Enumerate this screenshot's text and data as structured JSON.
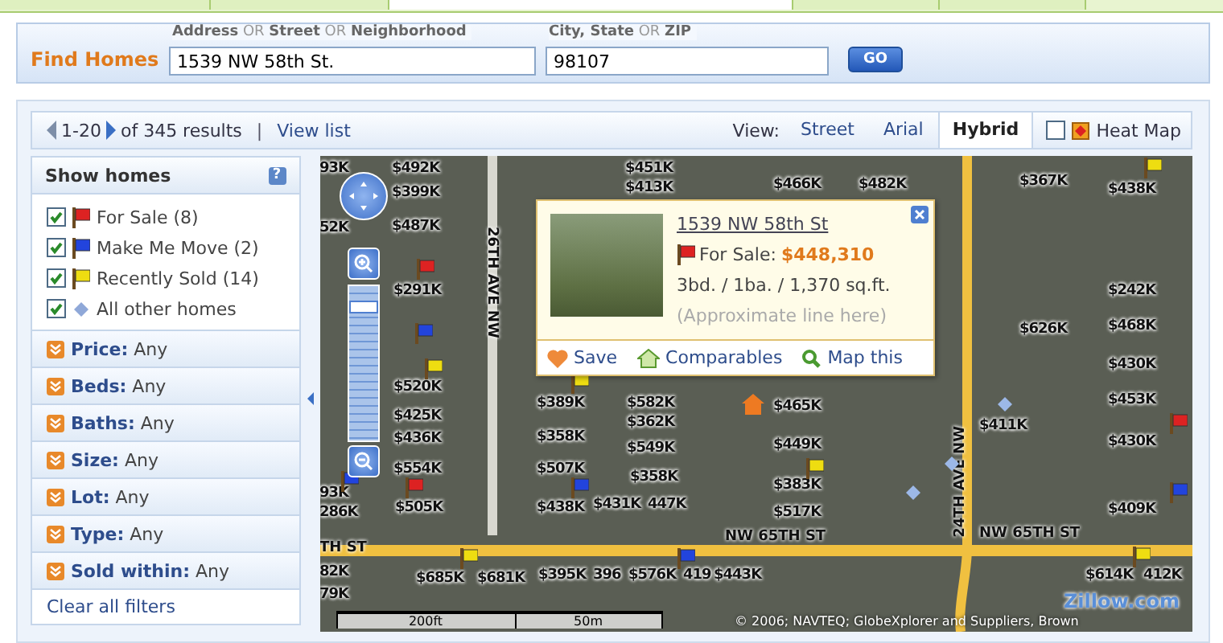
{
  "search": {
    "title": "Find Homes",
    "address": {
      "label": "**Address** OR **Street** OR **Neighborhood**",
      "value": "1539 NW 58th St."
    },
    "city": {
      "label": "**City, State** OR **ZIP**",
      "value": "98107"
    },
    "button": "GO"
  },
  "results": {
    "range": "1-20",
    "total": "of 345 results",
    "separator": "|",
    "view_list": "View list",
    "view_label": "View:",
    "views": [
      {
        "label": "Street",
        "selected": false
      },
      {
        "label": "Arial",
        "selected": false
      },
      {
        "label": "Hybrid",
        "selected": true
      }
    ],
    "heat_map": {
      "label": "Heat Map",
      "checked": false
    }
  },
  "sidebar": {
    "title": "Show homes",
    "help": "?",
    "home_types": [
      {
        "label": "For Sale (8)",
        "checked": true,
        "kind": "flag",
        "color": "#dd2222"
      },
      {
        "label": "Make Me Move (2)",
        "checked": true,
        "kind": "flag",
        "color": "#2244dd"
      },
      {
        "label": "Recently Sold (14)",
        "checked": true,
        "kind": "flag",
        "color": "#eedd11"
      },
      {
        "label": "All other homes",
        "checked": true,
        "kind": "diamond",
        "color": "#8fa8d8"
      }
    ],
    "filters": [
      {
        "name": "Price:",
        "value": "Any"
      },
      {
        "name": "Beds:",
        "value": "Any"
      },
      {
        "name": "Baths:",
        "value": "Any"
      },
      {
        "name": "Size:",
        "value": "Any"
      },
      {
        "name": "Lot:",
        "value": "Any"
      },
      {
        "name": "Type:",
        "value": "Any"
      },
      {
        "name": "Sold within:",
        "value": "Any"
      }
    ],
    "clear": "Clear all filters"
  },
  "map": {
    "zoom": {
      "level": 0.9
    },
    "prices": [
      "$492K",
      "$399K",
      "$487K",
      "$291K",
      "$520K",
      "$425K",
      "$436K",
      "$554K",
      "$505K",
      "$389K",
      "$582K",
      "$362K",
      "$358K",
      "$549K",
      "$507K",
      "$358K",
      "$438K",
      "$431K",
      "447K",
      "$685K",
      "$681K",
      "$395K",
      "396",
      "$576K",
      "419",
      "$443K",
      "$451K",
      "$413K",
      "93K",
      "52K",
      "93K",
      "286K",
      "82K",
      "79K",
      "$466K",
      "$482K",
      "$367K",
      "$438K",
      "$242K",
      "$468K",
      "$626K",
      "$430K",
      "$453K",
      "$465K",
      "$411K",
      "$449K",
      "$430K",
      "$383K",
      "$517K",
      "$409K",
      "$614K",
      "412K"
    ],
    "pins": [
      {
        "kind": "for_sale"
      },
      {
        "kind": "for_sale"
      },
      {
        "kind": "for_sale"
      },
      {
        "kind": "make_me_move"
      },
      {
        "kind": "make_me_move"
      },
      {
        "kind": "make_me_move"
      },
      {
        "kind": "make_me_move"
      },
      {
        "kind": "make_me_move"
      },
      {
        "kind": "recently_sold"
      },
      {
        "kind": "recently_sold"
      },
      {
        "kind": "recently_sold"
      },
      {
        "kind": "recently_sold"
      },
      {
        "kind": "recently_sold"
      },
      {
        "kind": "recently_sold"
      },
      {
        "kind": "other"
      },
      {
        "kind": "other"
      },
      {
        "kind": "other"
      },
      {
        "kind": "selected"
      }
    ],
    "streets": [
      {
        "name": "26TH AVE NW",
        "kind": "down"
      },
      {
        "name": "24TH AVE NW",
        "kind": "up"
      },
      {
        "name": "NW 65TH ST",
        "kind": "across"
      },
      {
        "name": "NW 65TH ST",
        "kind": "across"
      },
      {
        "name": "TH ST",
        "kind": "across"
      }
    ],
    "popup": {
      "address": "1539 NW 58th St",
      "status": "For Sale:",
      "price": "$448,310",
      "details": "3bd. / 1ba. / 1,370 sq.ft.",
      "note": "(Approximate line here)",
      "actions": [
        "Save",
        "Comparables",
        "Map this"
      ]
    },
    "logo": "Zillow.com",
    "copyright": "© 2006; NAVTEQ; GlobeXplorer and Suppliers, Brown",
    "scale": [
      "200ft",
      "50m"
    ]
  }
}
